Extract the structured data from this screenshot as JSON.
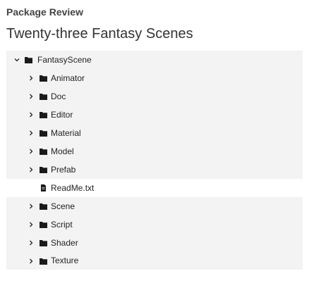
{
  "header": {
    "review_label": "Package Review",
    "title": "Twenty-three Fantasy Scenes"
  },
  "tree": {
    "root": {
      "label": "FantasyScene",
      "expanded": true,
      "icon": "folder-icon"
    },
    "children": [
      {
        "label": "Animator",
        "type": "folder",
        "expanded": false
      },
      {
        "label": "Doc",
        "type": "folder",
        "expanded": false
      },
      {
        "label": "Editor",
        "type": "folder",
        "expanded": false
      },
      {
        "label": "Material",
        "type": "folder",
        "expanded": false
      },
      {
        "label": "Model",
        "type": "folder",
        "expanded": false
      },
      {
        "label": "Prefab",
        "type": "folder",
        "expanded": false
      },
      {
        "label": "ReadMe.txt",
        "type": "file"
      },
      {
        "label": "Scene",
        "type": "folder",
        "expanded": false
      },
      {
        "label": "Script",
        "type": "folder",
        "expanded": false
      },
      {
        "label": "Shader",
        "type": "folder",
        "expanded": false
      },
      {
        "label": "Texture",
        "type": "folder",
        "expanded": false
      }
    ]
  },
  "colors": {
    "folder_row_bg": "#f3f3f3",
    "file_row_bg": "#ffffff",
    "icon": "#1a1a1a"
  }
}
